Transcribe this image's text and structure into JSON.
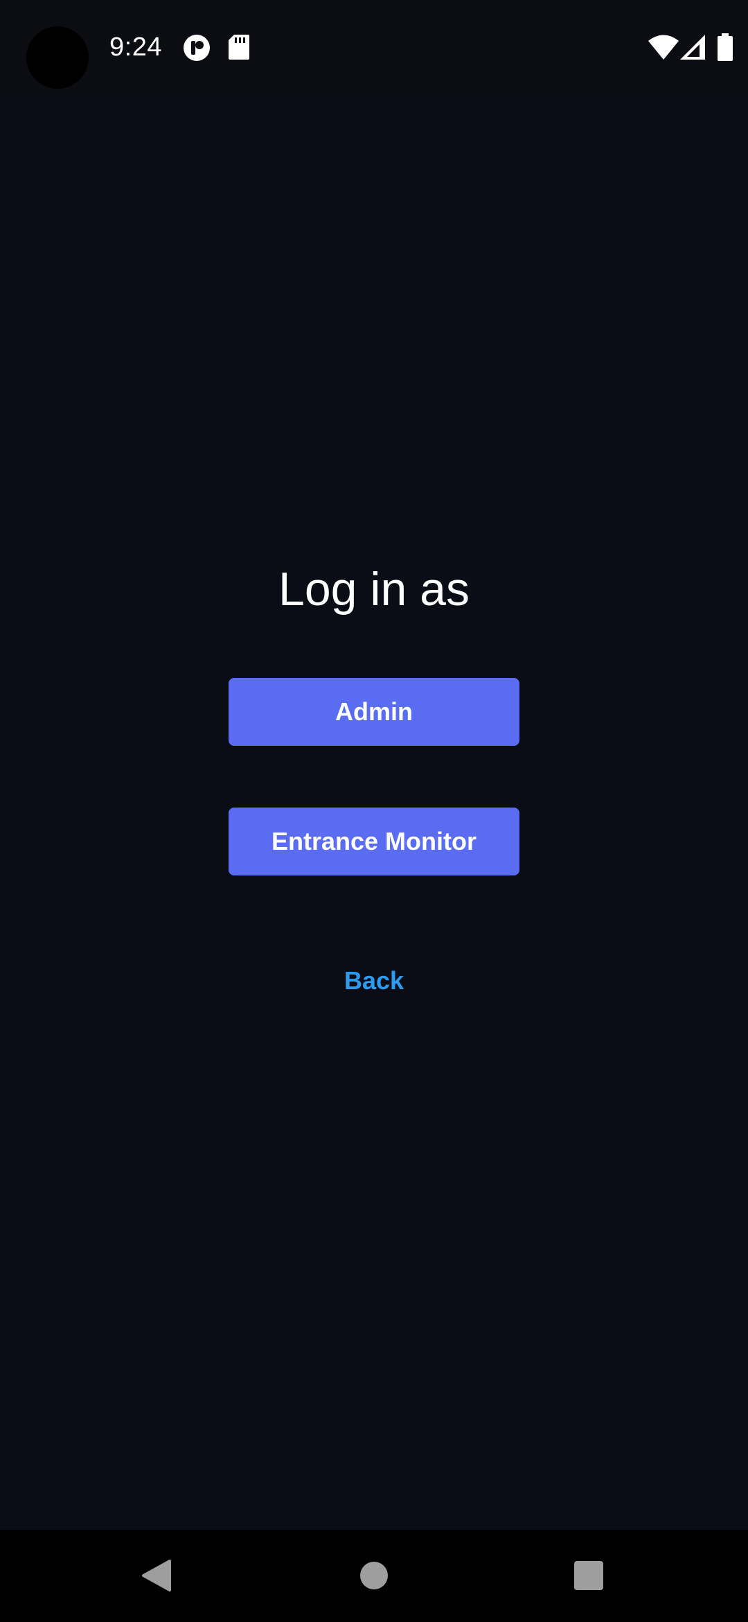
{
  "status_bar": {
    "time": "9:24",
    "icons": [
      "notification-app-icon",
      "sd-card-icon",
      "wifi-icon",
      "cellular-signal-icon",
      "battery-icon"
    ]
  },
  "main": {
    "title": "Log in as",
    "buttons": {
      "admin": "Admin",
      "entrance_monitor": "Entrance Monitor"
    },
    "back_label": "Back"
  },
  "nav_bar": {
    "icons": [
      "back-triangle-icon",
      "home-circle-icon",
      "recents-square-icon"
    ]
  },
  "colors": {
    "background": "#0a0d16",
    "primary_button": "#5a6cf2",
    "link": "#2d9bf0",
    "text": "#ffffff"
  }
}
